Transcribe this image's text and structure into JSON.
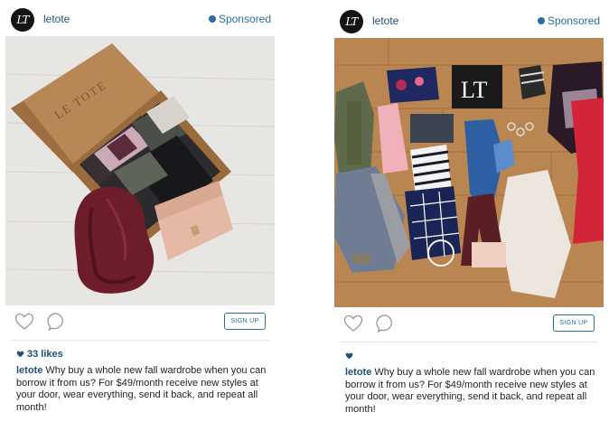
{
  "posts": [
    {
      "avatar_text": "LT",
      "username": "letote",
      "sponsored_label": "Sponsored",
      "signup_label": "SIGN UP",
      "likes_label": "33 likes",
      "caption_user": "letote",
      "caption_text": "Why buy a whole new fall wardrobe when you can borrow it from us? For $49/month receive new styles at your door, wear everything, send it back, and repeat all month!",
      "photo_box_text": "LE TOTE",
      "photo_label": "box-of-clothes-photo"
    },
    {
      "avatar_text": "LT",
      "username": "letote",
      "sponsored_label": "Sponsored",
      "signup_label": "SIGN UP",
      "likes_label": "",
      "caption_user": "letote",
      "caption_text": "Why buy a whole new fall wardrobe when you can borrow it from us? For $49/month receive new styles at your door, wear everything, send it back, and repeat all month!",
      "photo_box_text": "LT",
      "photo_label": "clothes-flatlay-photo"
    }
  ],
  "colors": {
    "link": "#1e4f7a",
    "accent": "#2b6ea3"
  }
}
